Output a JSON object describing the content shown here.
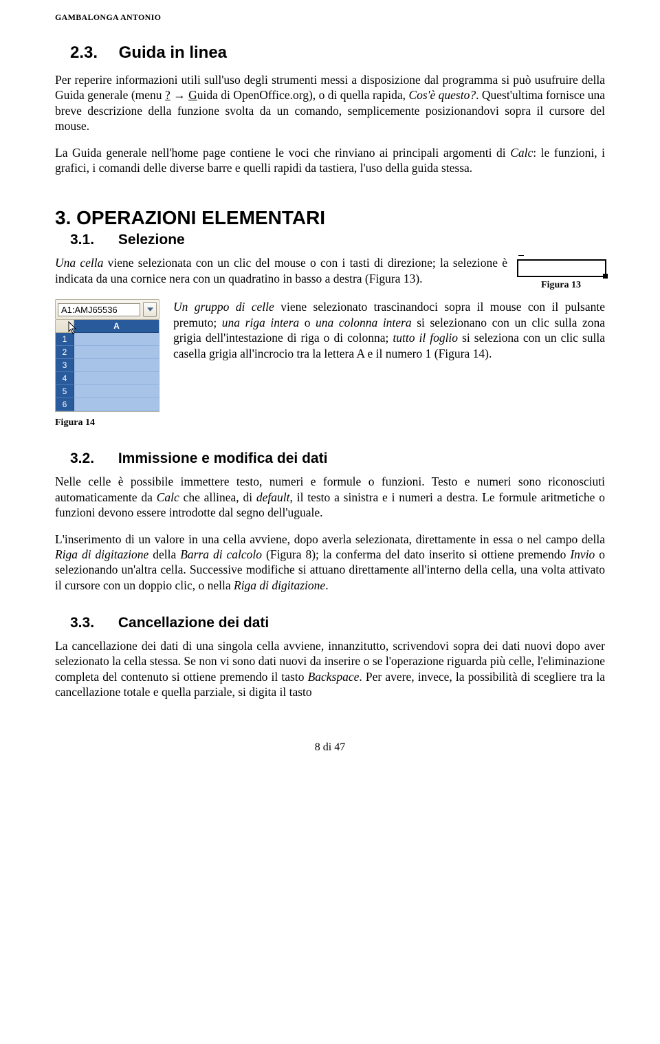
{
  "header": {
    "author": "GAMBALONGA ANTONIO"
  },
  "s23": {
    "num": "2.3.",
    "title": "Guida in linea",
    "p1": "Per reperire informazioni utili sull'uso degli strumenti messi a disposizione dal programma si può usufruire della Guida generale (menu ? → Guida di OpenOffice.org), o di quella rapida, Cos'è questo?. Quest'ultima fornisce una breve descrizione della funzione svolta da un comando, semplicemente posizionandovi sopra il cursore del mouse.",
    "p2": "La Guida generale nell'home page contiene le voci che rinviano ai principali argomenti di Calc: le funzioni, i grafici, i comandi delle diverse barre e quelli rapidi da tastiera, l'uso della guida stessa."
  },
  "s3": {
    "title": "3. OPERAZIONI ELEMENTARI"
  },
  "s31": {
    "num": "3.1.",
    "title": "Selezione",
    "p1": "Una cella viene selezionata con un clic del mouse o con i tasti di direzione; la selezione è indicata da una cornice nera con un quadratino in basso a destra (Figura 13).",
    "fig13_cap": "Figura 13",
    "p2": "Un gruppo di celle viene selezionato trascinandoci sopra il mouse con il pulsante premuto; una riga intera o una colonna intera si selezionano con un clic sulla zona grigia dell'intestazione di riga o di colonna; tutto il foglio si seleziona con un clic sulla casella grigia all'incrocio tra la lettera A e il numero 1 (Figura 14).",
    "fig14_cap": "Figura 14",
    "namebox": "A1:AMJ65536",
    "col": "A",
    "rows": [
      "1",
      "2",
      "3",
      "4",
      "5",
      "6"
    ]
  },
  "s32": {
    "num": "3.2.",
    "title": "Immissione e modifica dei dati",
    "p1": "Nelle celle è possibile immettere testo, numeri e formule o funzioni. Testo e numeri sono riconosciuti automaticamente da Calc che allinea, di default, il testo a sinistra e i numeri a destra. Le formule aritmetiche o funzioni devono essere introdotte dal segno dell'uguale.",
    "p2": "L'inserimento di un valore in una cella avviene, dopo averla selezionata, direttamente in essa o nel campo della Riga di digitazione della Barra di calcolo (Figura 8); la conferma del dato inserito si ottiene premendo Invio o selezionando un'altra cella. Successive modifiche si attuano direttamente all'interno della cella, una volta attivato il cursore con un doppio clic, o nella Riga di digitazione."
  },
  "s33": {
    "num": "3.3.",
    "title": "Cancellazione dei dati",
    "p1": "La cancellazione dei dati di una singola cella avviene, innanzitutto, scrivendovi sopra dei dati nuovi dopo aver selezionato la cella stessa. Se non vi sono dati nuovi da inserire o se l'operazione riguarda più celle, l'eliminazione completa del contenuto si ottiene premendo il tasto Backspace. Per avere, invece, la possibilità di scegliere tra la cancellazione totale e quella parziale, si digita il tasto"
  },
  "footer": {
    "page": "8 di 47"
  }
}
